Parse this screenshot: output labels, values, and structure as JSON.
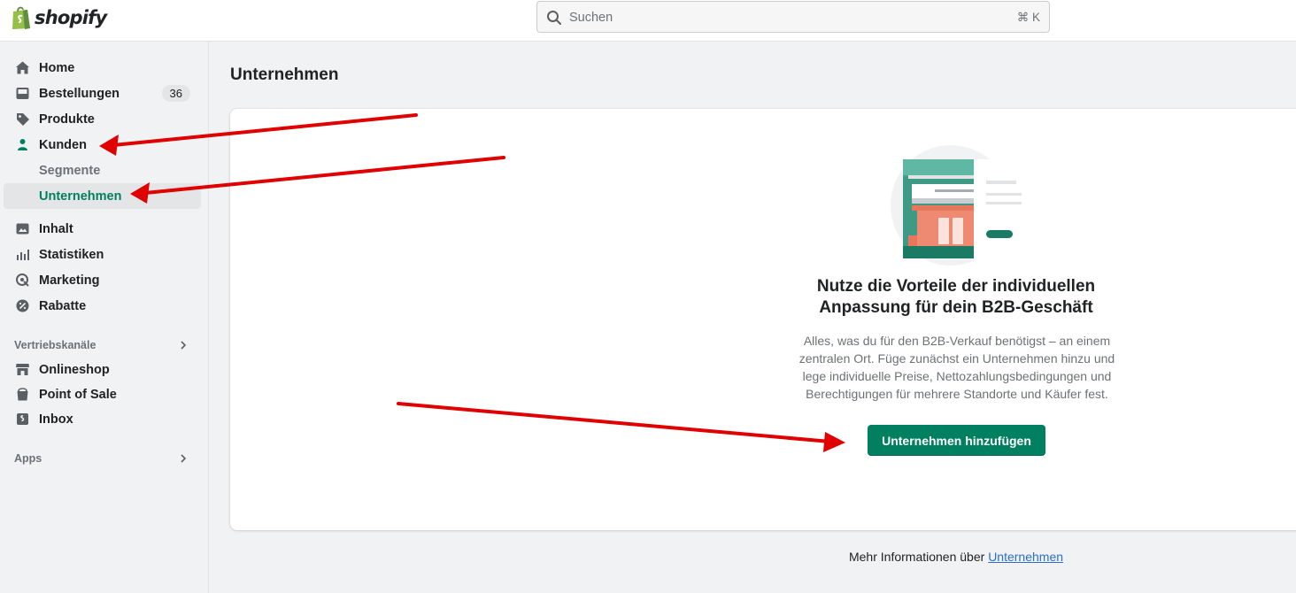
{
  "brand": {
    "name": "shopify"
  },
  "search": {
    "placeholder": "Suchen",
    "shortcut": "⌘ K"
  },
  "sidebar": {
    "items": [
      {
        "label": "Home",
        "icon": "home-icon"
      },
      {
        "label": "Bestellungen",
        "icon": "inbox-icon",
        "badge": "36"
      },
      {
        "label": "Produkte",
        "icon": "tag-icon"
      },
      {
        "label": "Kunden",
        "icon": "person-icon"
      },
      {
        "label": "Segmente"
      },
      {
        "label": "Unternehmen"
      },
      {
        "label": "Inhalt",
        "icon": "content-icon"
      },
      {
        "label": "Statistiken",
        "icon": "analytics-icon"
      },
      {
        "label": "Marketing",
        "icon": "target-icon"
      },
      {
        "label": "Rabatte",
        "icon": "discount-icon"
      }
    ],
    "sales_channels_title": "Vertriebskanäle",
    "channels": [
      {
        "label": "Onlineshop",
        "icon": "store-icon"
      },
      {
        "label": "Point of Sale",
        "icon": "pos-icon"
      },
      {
        "label": "Inbox",
        "icon": "inbox-app-icon"
      }
    ],
    "apps_title": "Apps"
  },
  "main": {
    "title": "Unternehmen",
    "empty_state": {
      "headline": "Nutze die Vorteile der individuellen Anpassung für dein B2B-Geschäft",
      "description": "Alles, was du für den B2B-Verkauf benötigst – an einem zentralen Ort. Füge zunächst ein Unternehmen hinzu und lege individuelle Preise, Nettozahlungsbedingungen und Berechtigungen für mehrere Standorte und Käufer fest.",
      "button": "Unternehmen hinzufügen"
    },
    "footer": {
      "prefix": "Mehr Informationen über",
      "link": "Unternehmen"
    }
  },
  "colors": {
    "accent": "#008060",
    "annotation": "#e00000",
    "link": "#2c6ecb"
  }
}
